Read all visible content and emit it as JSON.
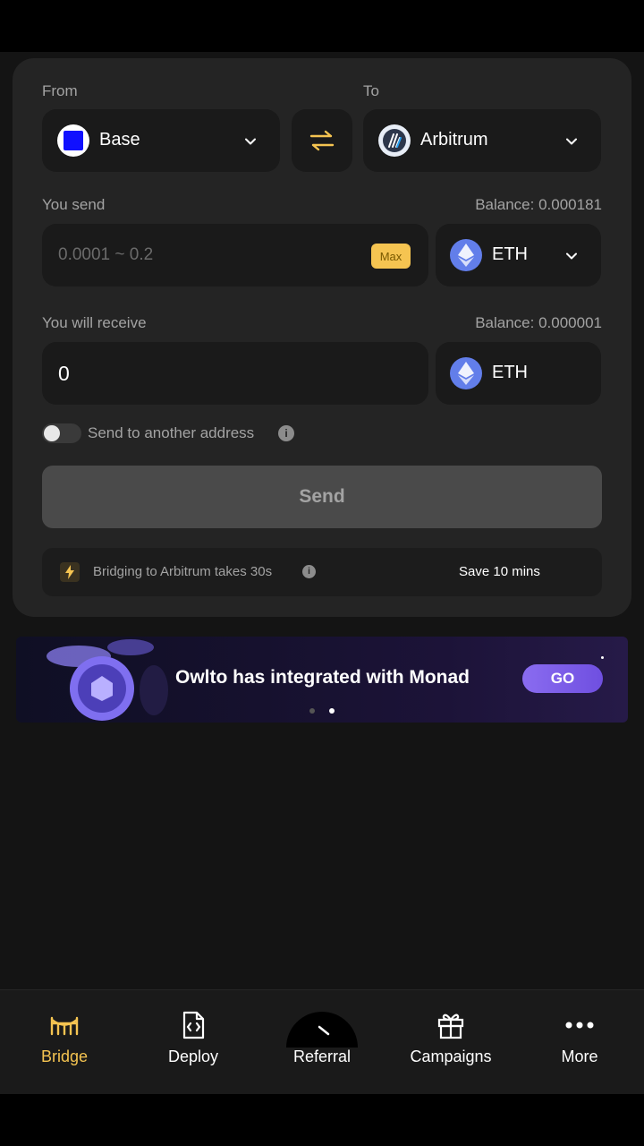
{
  "bridge": {
    "from_label": "From",
    "to_label": "To",
    "from_chain": "Base",
    "to_chain": "Arbitrum",
    "send_label": "You send",
    "send_balance": "Balance: 0.000181",
    "send_placeholder": "0.0001 ~ 0.2",
    "max_label": "Max",
    "send_token": "ETH",
    "receive_label": "You will receive",
    "receive_balance": "Balance: 0.000001",
    "receive_amount": "0",
    "receive_token": "ETH",
    "toggle_label": "Send to another address",
    "send_button": "Send",
    "info_text": "Bridging to Arbitrum takes 30s",
    "save_text": "Save 10 mins"
  },
  "banner": {
    "title": "Owlto has integrated with Monad",
    "go_label": "GO"
  },
  "tabs": [
    {
      "label": "Bridge",
      "icon": "bridge-icon",
      "active": true
    },
    {
      "label": "Deploy",
      "icon": "code-file-icon",
      "active": false
    },
    {
      "label": "Referral",
      "icon": "badge-icon",
      "active": false
    },
    {
      "label": "Campaigns",
      "icon": "gift-icon",
      "active": false
    },
    {
      "label": "More",
      "icon": "more-dots-icon",
      "active": false
    }
  ],
  "colors": {
    "accent": "#f5c451",
    "card": "#242424",
    "background": "#141414"
  }
}
